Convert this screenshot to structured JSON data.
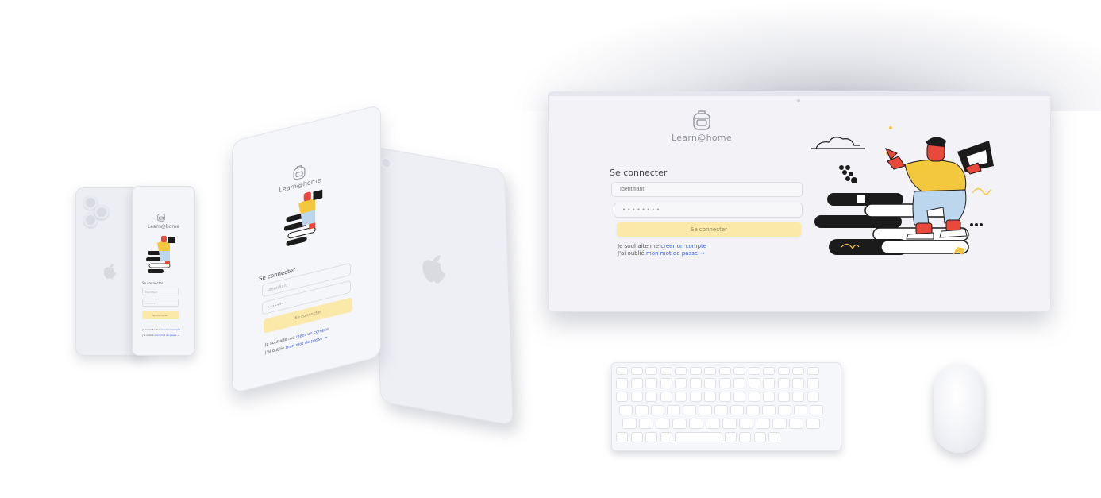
{
  "app": {
    "brand": "Learn@home"
  },
  "login": {
    "title": "Se connecter",
    "username_placeholder": "Identifiant",
    "password_value": "••••••••",
    "submit_label": "Se connecter",
    "signup_prefix": "Je souhaite me",
    "signup_link": "créer un compte",
    "forgot_prefix": "J'ai oublié",
    "forgot_link": "mon mot de passe",
    "forgot_arrow": "→"
  },
  "colors": {
    "accent_button": "#fbe9a9",
    "link": "#3b5bd6",
    "character_shirt": "#f4c83c",
    "character_pants": "#bcd6ee",
    "character_skin": "#e9493a"
  },
  "icons": {
    "logo": "backpack-icon",
    "device_back_logo": "apple-logo-icon",
    "arrow": "arrow-right-icon"
  }
}
